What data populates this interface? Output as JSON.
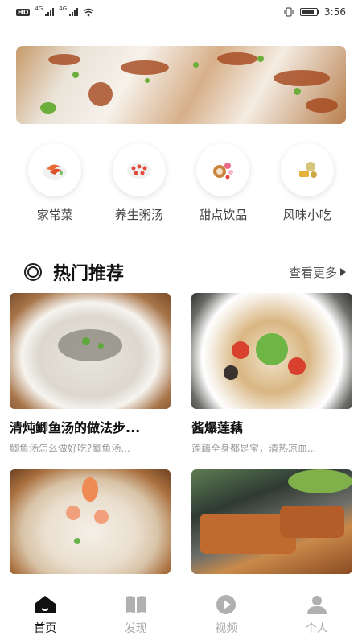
{
  "status_bar": {
    "hd": "HD",
    "net1": "4G",
    "net2": "4G",
    "time": "3:56"
  },
  "categories": [
    {
      "label": "家常菜",
      "icon": "shrimp-dish-icon"
    },
    {
      "label": "养生粥汤",
      "icon": "soup-bowl-icon"
    },
    {
      "label": "甜点饮品",
      "icon": "dessert-icon"
    },
    {
      "label": "风味小吃",
      "icon": "snack-icon"
    }
  ],
  "section": {
    "title": "热门推荐",
    "more": "查看更多"
  },
  "recipes": [
    {
      "title": "清炖鲫鱼汤的做法步...",
      "desc": "鲫鱼汤怎么做好吃?鲫鱼汤..."
    },
    {
      "title": "酱爆莲藕",
      "desc": "莲藕全身都是宝，清热凉血..."
    },
    {
      "title": "",
      "desc": ""
    },
    {
      "title": "",
      "desc": ""
    }
  ],
  "bottom_nav": [
    {
      "label": "首页",
      "icon": "home-icon",
      "active": true
    },
    {
      "label": "发现",
      "icon": "book-icon",
      "active": false
    },
    {
      "label": "视频",
      "icon": "play-icon",
      "active": false
    },
    {
      "label": "个人",
      "icon": "person-icon",
      "active": false
    }
  ],
  "colors": {
    "active": "#111111",
    "inactive": "#aaaaaa"
  }
}
